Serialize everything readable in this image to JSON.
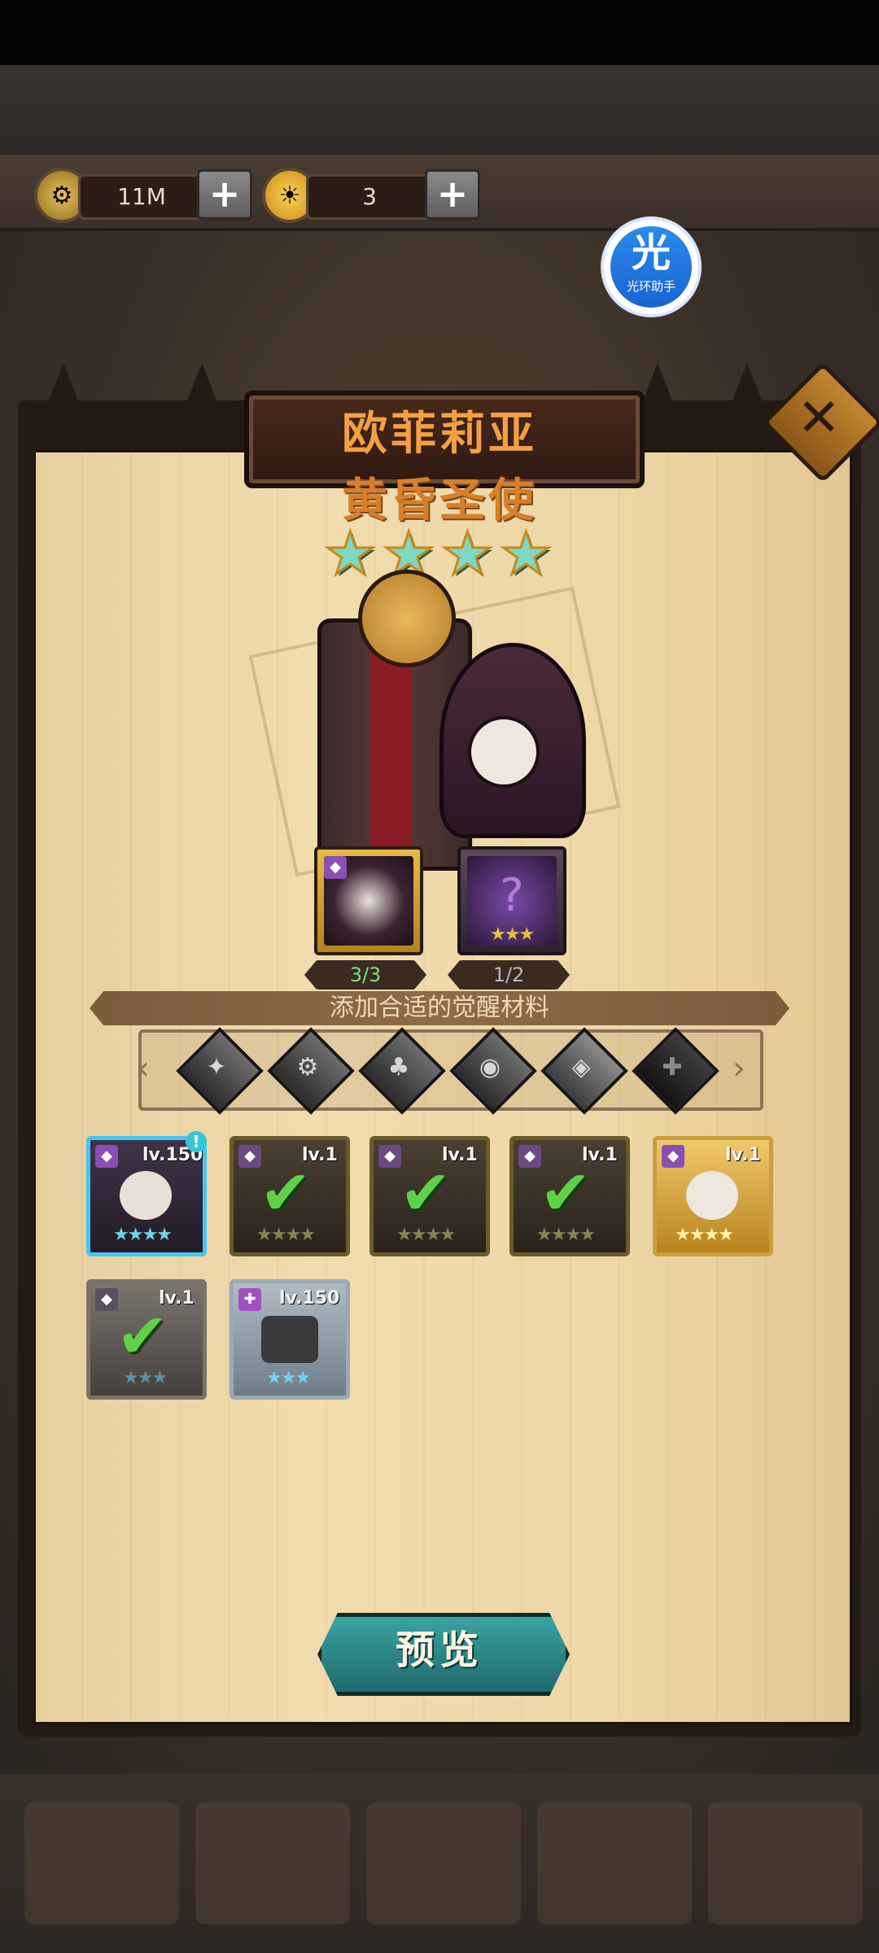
{
  "resources": {
    "gold": {
      "icon": "gold-coin-icon",
      "value": "11M"
    },
    "gem": {
      "icon": "awaken-crystal-icon",
      "value": "3"
    }
  },
  "helper": {
    "char": "光",
    "label": "光环助手"
  },
  "hero": {
    "name": "欧菲莉亚",
    "title": "黄昏圣使",
    "stars": 4
  },
  "requirements": [
    {
      "count": "3/3",
      "color": "#7ee07a",
      "stars": ""
    },
    {
      "count": "1/2",
      "color": "#b9b9b9",
      "stars": "★★★"
    }
  ],
  "banner": "添加合适的觉醒材料",
  "filters": [
    "all-factions-icon",
    "faction-gear-icon",
    "faction-clover-icon",
    "faction-shield-icon",
    "faction-eye-icon",
    "faction-dark-icon"
  ],
  "materials": [
    {
      "level": "lv.150",
      "stars": "★★★★",
      "state": "selected",
      "checked": false,
      "alert": "!"
    },
    {
      "level": "lv.1",
      "stars": "★★★★",
      "state": "gold",
      "checked": true
    },
    {
      "level": "lv.1",
      "stars": "★★★★",
      "state": "gold",
      "checked": true
    },
    {
      "level": "lv.1",
      "stars": "★★★★",
      "state": "gold",
      "checked": true
    },
    {
      "level": "lv.1",
      "stars": "★★★★",
      "state": "bright",
      "checked": false
    },
    {
      "level": "lv.1",
      "stars": "★★★",
      "state": "grey",
      "checked": true
    },
    {
      "level": "lv.150",
      "stars": "★★★",
      "state": "pale",
      "checked": false
    }
  ],
  "preview_label": "预览",
  "close_label": "✕"
}
